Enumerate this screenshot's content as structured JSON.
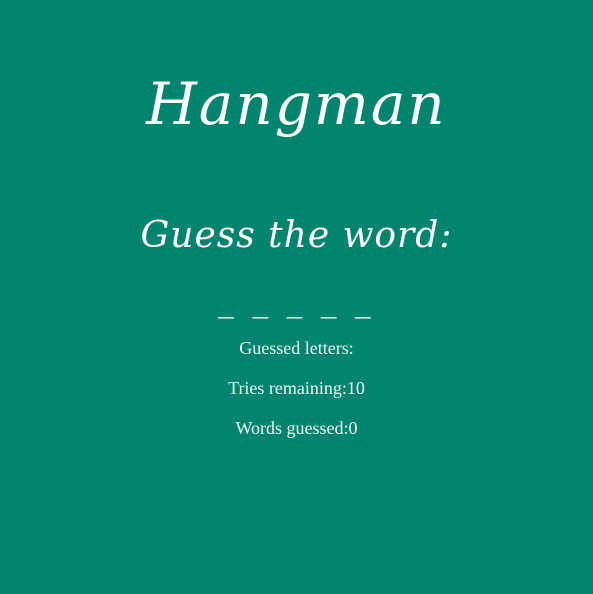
{
  "game": {
    "title": "Hangman",
    "prompt": "Guess the word:",
    "word_display": "_ _ _ _ _",
    "guessed_letters_label": "Guessed letters:",
    "guessed_letters_value": "",
    "tries_remaining_label": "Tries remaining:",
    "tries_remaining_value": "10",
    "words_guessed_label": "Words guessed:",
    "words_guessed_value": "0"
  },
  "colors": {
    "background": "#02846f",
    "text": "#ffffff"
  }
}
